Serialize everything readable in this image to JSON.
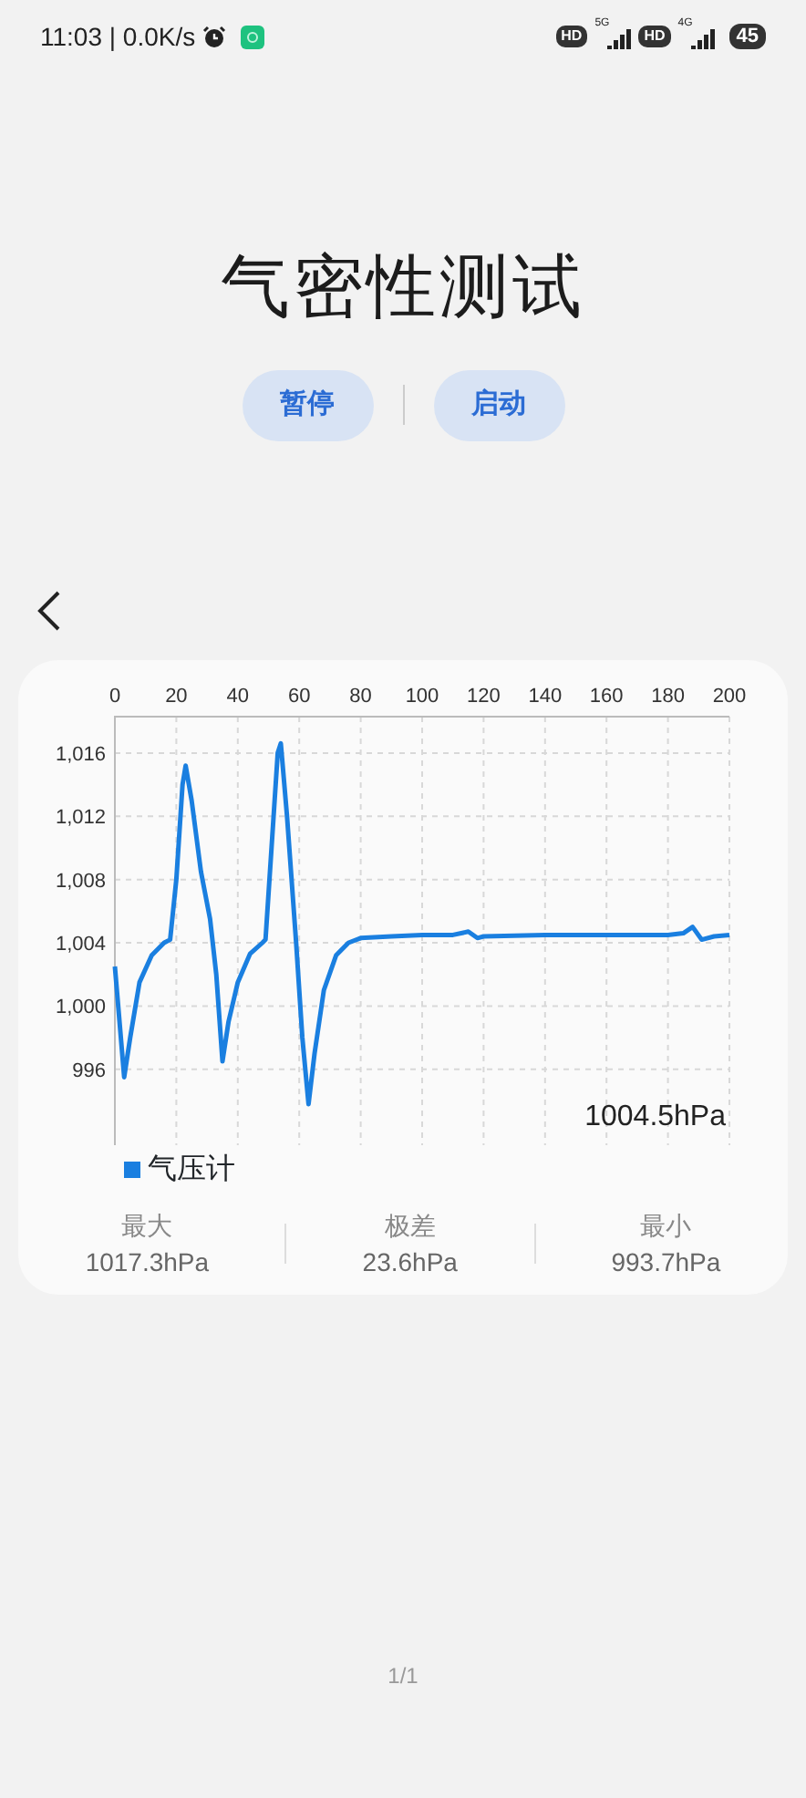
{
  "status_bar": {
    "time": "11:03 | 0.0K/s",
    "indicators": [
      {
        "kind": "hd",
        "label": "HD"
      },
      {
        "kind": "signal",
        "label": "5G"
      },
      {
        "kind": "hd",
        "label": "HD"
      },
      {
        "kind": "signal",
        "label": "4G"
      }
    ],
    "battery": "45"
  },
  "title": "气密性测试",
  "buttons": [
    {
      "label": "暂停"
    },
    {
      "label": "启动"
    }
  ],
  "chart_card": {
    "chart_data": {
      "type": "line",
      "x": [
        0,
        3,
        5,
        8,
        12,
        16,
        18,
        20,
        22,
        23,
        25,
        28,
        31,
        33,
        35,
        37,
        40,
        44,
        48,
        49,
        51,
        53,
        54,
        56,
        59,
        61,
        63,
        65,
        68,
        72,
        76,
        80,
        90,
        100,
        110,
        115,
        118,
        120,
        140,
        160,
        180,
        185,
        188,
        191,
        195,
        200
      ],
      "series": [
        {
          "name": "气压计",
          "color": "#1a7fe0",
          "values": [
            1002.5,
            995.5,
            998,
            1001.5,
            1003.2,
            1004,
            1004.2,
            1008,
            1014,
            1015.2,
            1013,
            1008.5,
            1005.5,
            1002,
            996.5,
            999,
            1001.5,
            1003.3,
            1004,
            1004.2,
            1010,
            1016,
            1016.6,
            1012,
            1004,
            998,
            993.8,
            997,
            1001,
            1003.2,
            1004,
            1004.3,
            1004.4,
            1004.5,
            1004.5,
            1004.7,
            1004.3,
            1004.4,
            1004.5,
            1004.5,
            1004.5,
            1004.6,
            1005,
            1004.2,
            1004.4,
            1004.5
          ]
        }
      ],
      "grid": true,
      "xlim": [
        0,
        200
      ],
      "ylim": [
        991.2,
        1018.3
      ],
      "xticks": [
        0,
        20,
        40,
        60,
        80,
        100,
        120,
        140,
        160,
        180,
        200
      ],
      "yticks": [
        {
          "value": 996,
          "label": "996"
        },
        {
          "value": 1000,
          "label": "1,000"
        },
        {
          "value": 1004,
          "label": "1,004"
        },
        {
          "value": 1008,
          "label": "1,008"
        },
        {
          "value": 1012,
          "label": "1,012"
        },
        {
          "value": 1016,
          "label": "1,016"
        }
      ]
    },
    "current_reading": "1004.5hPa",
    "stats": [
      {
        "label": "最大",
        "value": "1017.3hPa"
      },
      {
        "label": "极差",
        "value": "23.6hPa"
      },
      {
        "label": "最小",
        "value": "993.7hPa"
      }
    ]
  },
  "page_indicator": "1/1"
}
